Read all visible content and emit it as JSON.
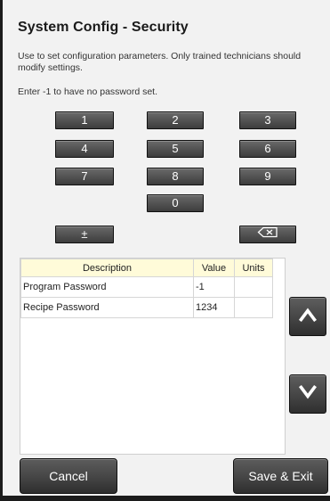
{
  "title": "System Config - Security",
  "description": "Use to set configuration parameters. Only trained technicians should modify settings.",
  "hint": "Enter -1 to have no password set.",
  "keypad": {
    "k1": "1",
    "k2": "2",
    "k3": "3",
    "k4": "4",
    "k5": "5",
    "k6": "6",
    "k7": "7",
    "k8": "8",
    "k9": "9",
    "k0": "0",
    "plus_minus": "±",
    "backspace_icon": "backspace-icon"
  },
  "table": {
    "headers": {
      "description": "Description",
      "value": "Value",
      "units": "Units"
    },
    "rows": [
      {
        "description": "Program Password",
        "value": "-1",
        "units": ""
      },
      {
        "description": "Recipe Password",
        "value": "1234",
        "units": ""
      }
    ]
  },
  "scroll": {
    "up_icon": "chevron-up-icon",
    "down_icon": "chevron-down-icon"
  },
  "buttons": {
    "cancel": "Cancel",
    "save_exit": "Save & Exit"
  },
  "colors": {
    "header_bg": "#fffbd9",
    "button_dark": "#474747",
    "background": "#f2f2f2"
  }
}
